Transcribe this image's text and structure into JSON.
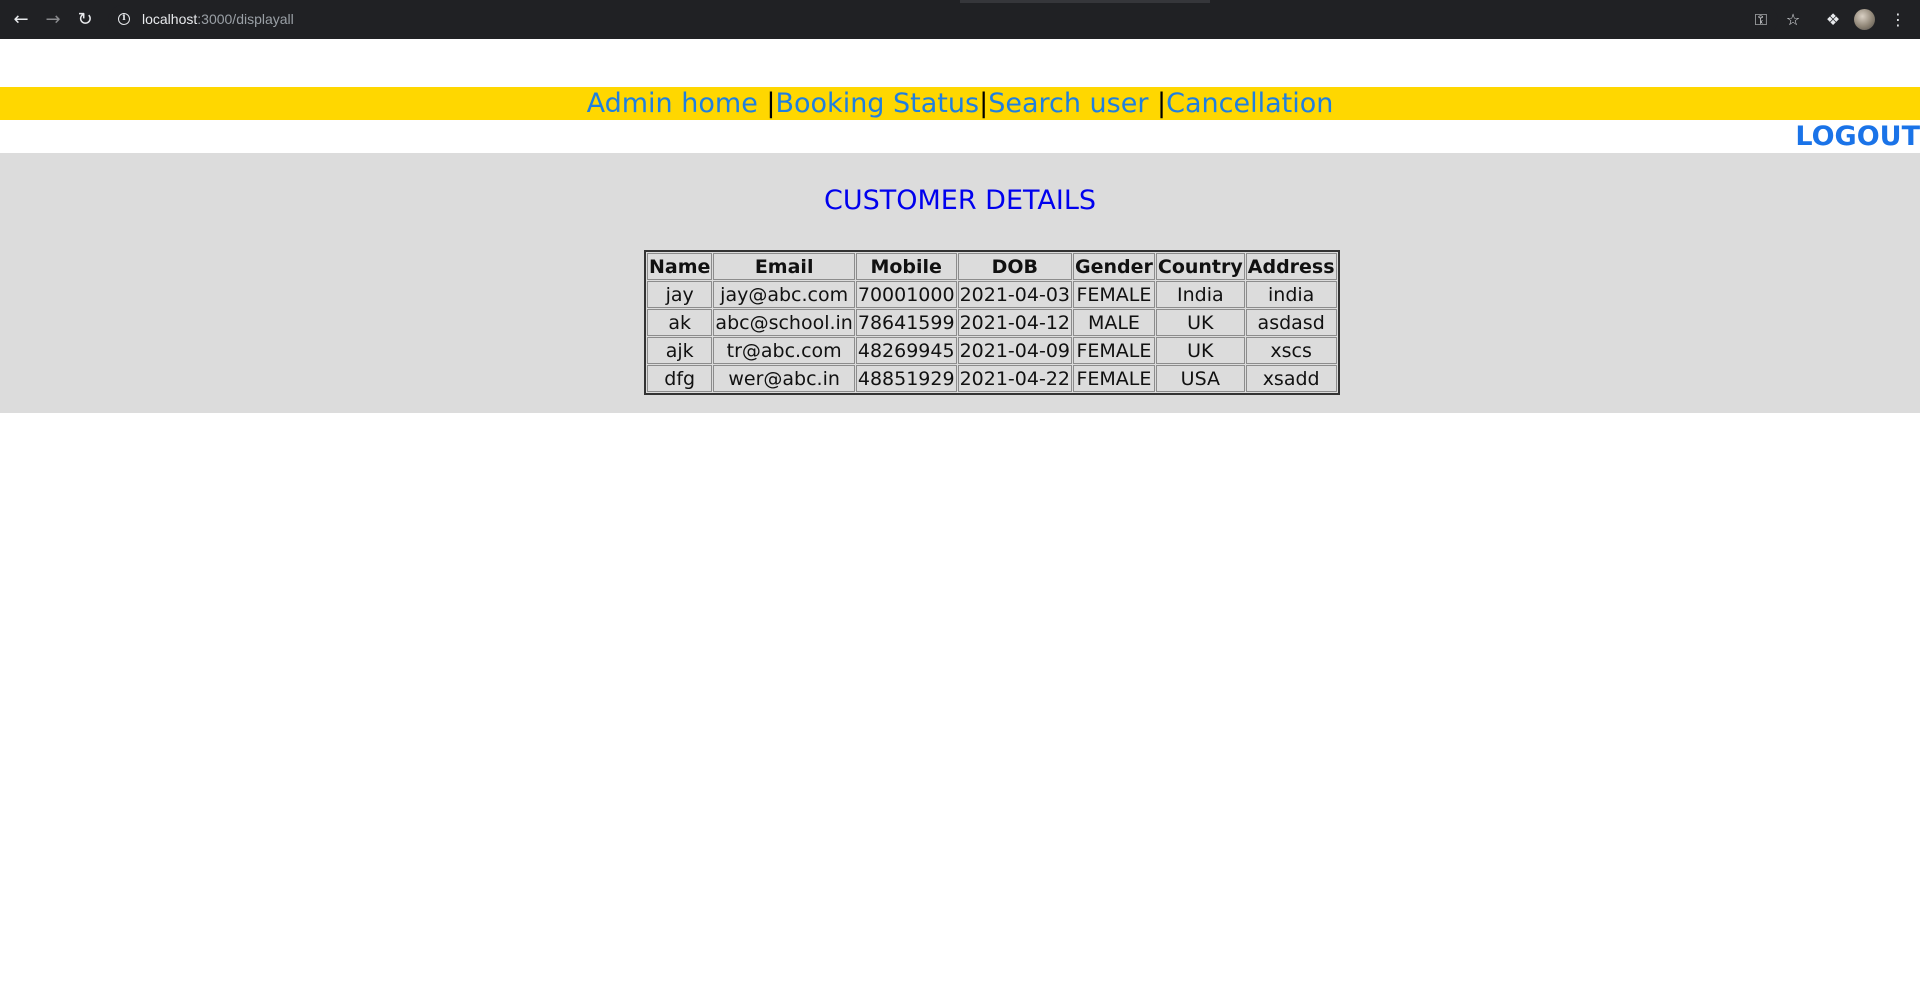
{
  "browser": {
    "url_host": "localhost",
    "url_path": ":3000/displayall"
  },
  "nav": {
    "admin_home": "Admin home ",
    "sep1": "|",
    "booking_status": "Booking Status",
    "sep2": "|",
    "search_user": "Search user ",
    "sep3": "|",
    "cancellation": "Cancellation"
  },
  "logout_label": "LOGOUT",
  "heading": "CUSTOMER DETAILS",
  "table": {
    "headers": [
      "Name",
      "Email",
      "Mobile",
      "DOB",
      "Gender",
      "Country",
      "Address"
    ],
    "rows": [
      [
        "jay",
        "jay@abc.com",
        "70001000",
        "2021-04-03",
        "FEMALE",
        "India",
        "india"
      ],
      [
        "ak",
        "abc@school.in",
        "78641599",
        "2021-04-12",
        "MALE",
        "UK",
        "asdasd"
      ],
      [
        "ajk",
        "tr@abc.com",
        "48269945",
        "2021-04-09",
        "FEMALE",
        "UK",
        "xscs"
      ],
      [
        "dfg",
        "wer@abc.in",
        "48851929",
        "2021-04-22",
        "FEMALE",
        "USA",
        "xsadd"
      ]
    ]
  },
  "colors": {
    "navbar_bg": "#ffd700",
    "link": "#1f7fe0",
    "heading": "#0000ee",
    "content_bg": "#dcdcdc"
  }
}
